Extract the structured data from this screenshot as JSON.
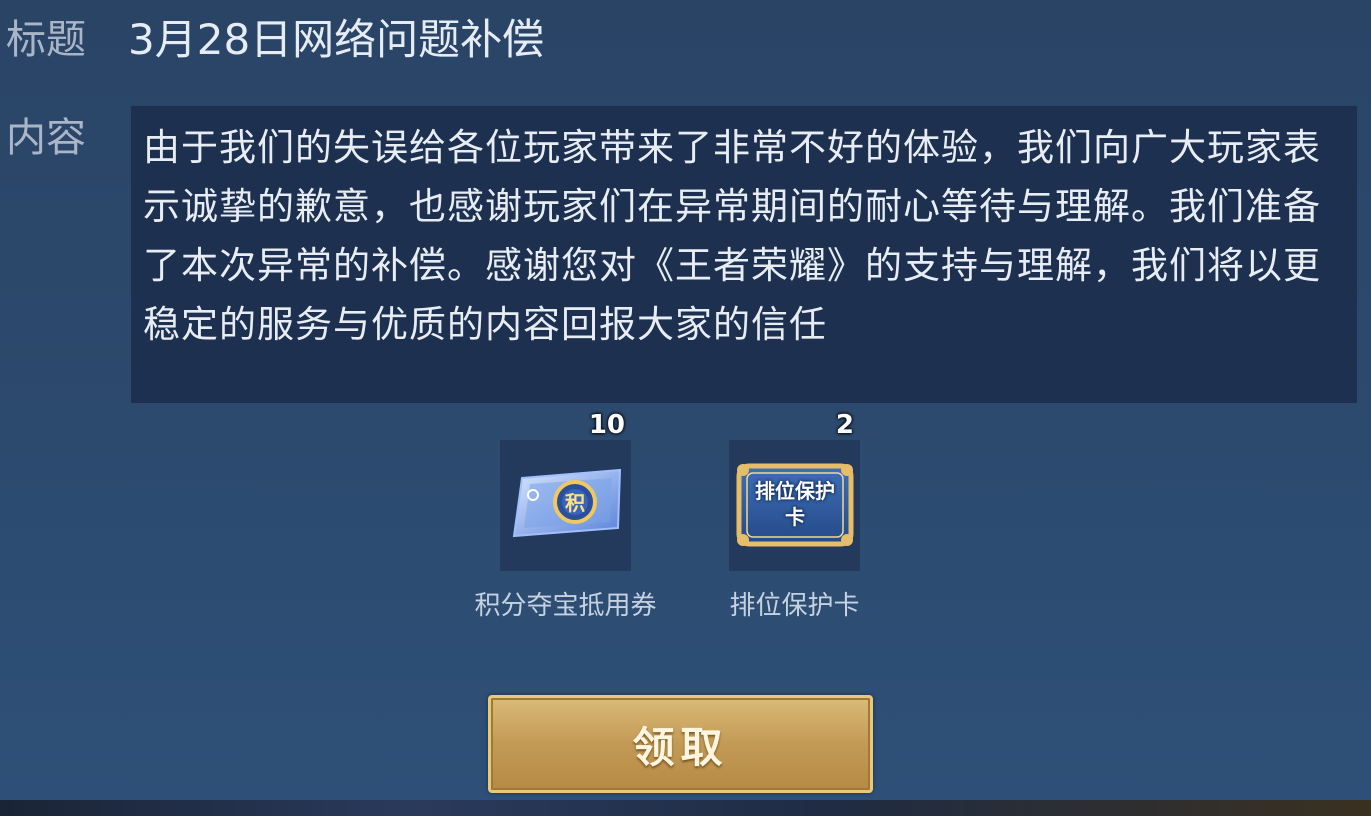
{
  "mail": {
    "title_label": "标题",
    "title": "3月28日网络问题补偿",
    "content_label": "内容",
    "content": "由于我们的失误给各位玩家带来了非常不好的体验，我们向广大玩家表示诚挚的歉意，也感谢玩家们在异常期间的耐心等待与理解。我们准备了本次异常的补偿。感谢您对《王者荣耀》的支持与理解，我们将以更稳定的服务与优质的内容回报大家的信任"
  },
  "rewards": [
    {
      "name": "积分夺宝抵用券",
      "count": "10",
      "icon": "lottery-voucher-icon",
      "icon_text": "积"
    },
    {
      "name": "排位保护卡",
      "count": "2",
      "icon": "rank-protection-card-icon",
      "icon_text": "排位保护卡"
    }
  ],
  "claim_button": {
    "label": "领取"
  },
  "colors": {
    "panel_bg": "#2a4466",
    "content_bg": "#1e3050",
    "button_gold": "#c9a45f"
  }
}
